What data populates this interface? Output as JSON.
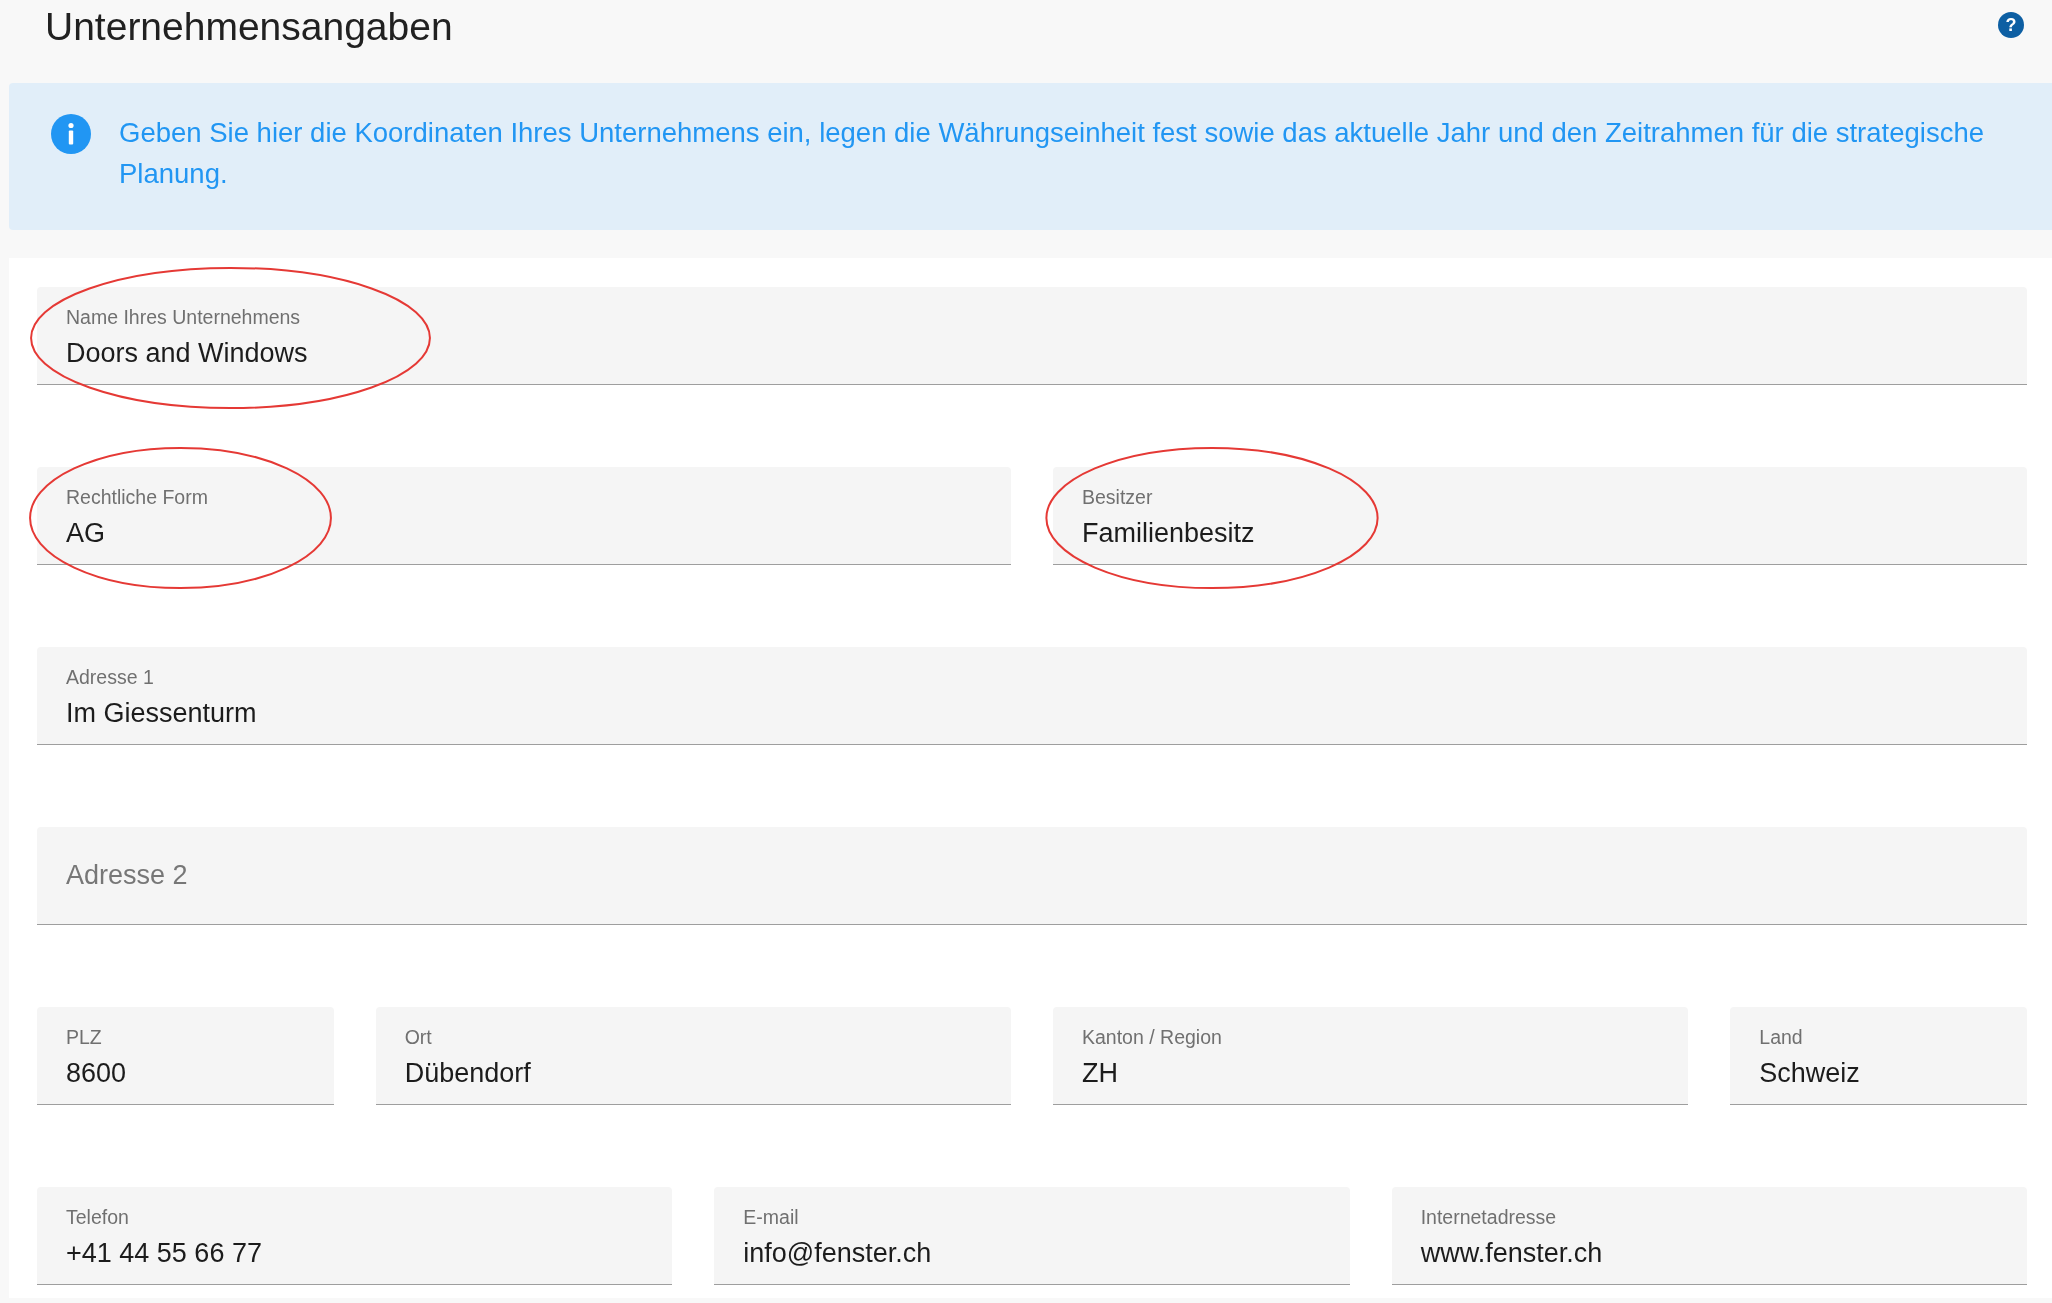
{
  "page": {
    "title": "Unternehmensangaben",
    "help": "?"
  },
  "info": {
    "text": "Geben Sie hier die Koordinaten Ihres Unternehmens ein, legen die Währungseinheit fest sowie das aktuelle Jahr und den Zeitrahmen für die strategische Planung."
  },
  "form": {
    "rows": [
      [
        {
          "label": "Name Ihres Unternehmens",
          "value": "Doors and Windows",
          "highlighted": true
        }
      ],
      [
        {
          "label": "Rechtliche Form",
          "value": "AG",
          "highlighted": true
        },
        {
          "label": "Besitzer",
          "value": "Familienbesitz",
          "highlighted": true
        }
      ],
      [
        {
          "label": "Adresse 1",
          "value": "Im Giessenturm",
          "highlighted": false
        }
      ],
      [
        {
          "placeholder": "Adresse 2",
          "highlighted": false
        }
      ],
      [
        {
          "label": "PLZ",
          "value": "8600",
          "highlighted": false
        },
        {
          "label": "Ort",
          "value": "Dübendorf",
          "highlighted": false
        },
        {
          "label": "Kanton / Region",
          "value": "ZH",
          "highlighted": false
        },
        {
          "label": "Land",
          "value": "Schweiz",
          "highlighted": false
        }
      ],
      [
        {
          "label": "Telefon",
          "value": "+41 44 55 66 77",
          "highlighted": false
        },
        {
          "label": "E-mail",
          "value": "info@fenster.ch",
          "highlighted": false
        },
        {
          "label": "Internetadresse",
          "value": "www.fenster.ch",
          "highlighted": false
        }
      ]
    ]
  }
}
